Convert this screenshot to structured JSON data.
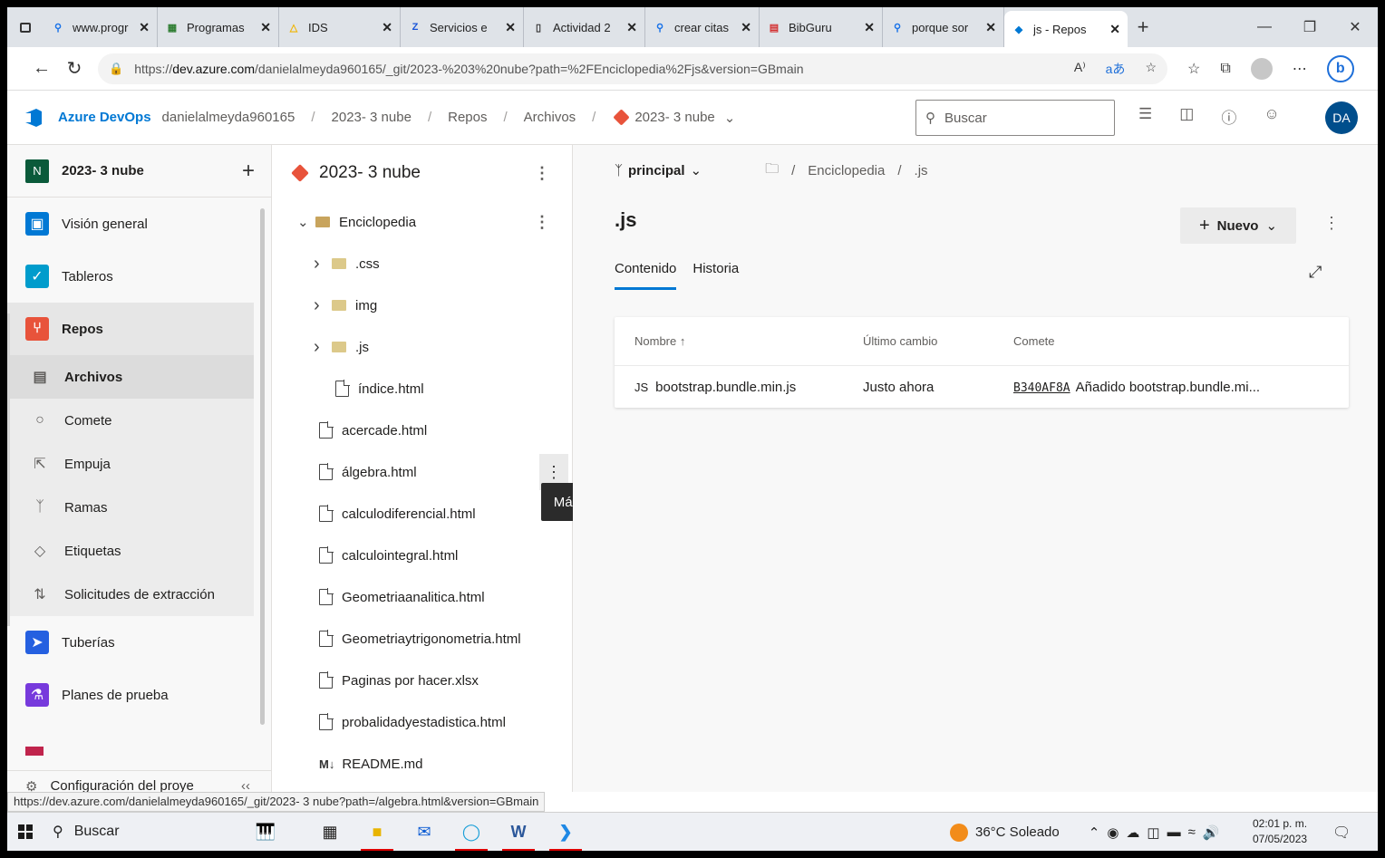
{
  "browser": {
    "tabs": [
      {
        "label": "www.progr",
        "icon": "search-icon",
        "color": "#1a73e8"
      },
      {
        "label": "Programas",
        "icon": "programs-icon",
        "color": "#2e7d32"
      },
      {
        "label": "IDS",
        "icon": "warning-icon",
        "color": "#f0b400"
      },
      {
        "label": "Servicios e",
        "icon": "z-icon",
        "color": "#1a55d8"
      },
      {
        "label": "Actividad 2",
        "icon": "page-icon",
        "color": "#333333"
      },
      {
        "label": "crear citas",
        "icon": "search-icon",
        "color": "#1a73e8"
      },
      {
        "label": "BibGuru",
        "icon": "book-icon",
        "color": "#d32f2f"
      },
      {
        "label": "porque sor",
        "icon": "search-icon",
        "color": "#1a73e8"
      },
      {
        "label": "js - Repos",
        "icon": "devops-icon",
        "color": "#0078d4",
        "active": true
      }
    ],
    "url_prefix": "https://",
    "url_host": "dev.azure.com",
    "url_path": "/danielalmeyda960165/_git/2023-%203%20nube?path=%2FEnciclopedia%2Fjs&version=GBmain",
    "read_aloud": "A⁾",
    "translate": "aあ"
  },
  "devops": {
    "brand": "Azure DevOps",
    "breadcrumbs": [
      "danielalmeyda960165",
      "2023- 3 nube",
      "Repos",
      "Archivos"
    ],
    "repo_picker": "2023- 3 nube",
    "search_placeholder": "Buscar",
    "avatar": "DA"
  },
  "sidebar": {
    "project": {
      "initial": "N",
      "name": "2023- 3 nube"
    },
    "items": [
      {
        "label": "Visión general",
        "icon": "overview-icon",
        "color": "#0078d4"
      },
      {
        "label": "Tableros",
        "icon": "boards-icon",
        "color": "#009ccc"
      },
      {
        "label": "Repos",
        "icon": "repos-icon",
        "color": "#e8533b",
        "selected": true
      },
      {
        "label": "Archivos",
        "icon": "files-icon",
        "sub": true,
        "selected": true
      },
      {
        "label": "Comete",
        "icon": "commit-icon",
        "sub": true
      },
      {
        "label": "Empuja",
        "icon": "push-icon",
        "sub": true
      },
      {
        "label": "Ramas",
        "icon": "branch-icon",
        "sub": true
      },
      {
        "label": "Etiquetas",
        "icon": "tag-icon",
        "sub": true
      },
      {
        "label": "Solicitudes de extracción",
        "icon": "pull-request-icon",
        "sub": true
      },
      {
        "label": "Tuberías",
        "icon": "pipelines-icon",
        "color": "#2560e0"
      },
      {
        "label": "Planes de prueba",
        "icon": "test-plans-icon",
        "color": "#773adc"
      }
    ],
    "config_label": "Configuración del proye"
  },
  "tree": {
    "title": "2023- 3 nube",
    "root": "Enciclopedia",
    "rows": [
      {
        "label": ".css",
        "kind": "folder",
        "depth": 1
      },
      {
        "label": "img",
        "kind": "folder",
        "depth": 1
      },
      {
        "label": ".js",
        "kind": "folder",
        "depth": 1
      },
      {
        "label": "índice.html",
        "kind": "code",
        "depth": 2
      },
      {
        "label": "acercade.html",
        "kind": "code",
        "depth": 0
      },
      {
        "label": "álgebra.html",
        "kind": "code",
        "depth": 0,
        "hover": true
      },
      {
        "label": "calculodiferencial.html",
        "kind": "code",
        "depth": 0
      },
      {
        "label": "calculointegral.html",
        "kind": "code",
        "depth": 0
      },
      {
        "label": "Geometriaanalitica.html",
        "kind": "code",
        "depth": 0
      },
      {
        "label": "Geometriaytrigonometria.html",
        "kind": "code",
        "depth": 0
      },
      {
        "label": "Paginas por hacer.xlsx",
        "kind": "file",
        "depth": 0
      },
      {
        "label": "probalidadyestadistica.html",
        "kind": "code",
        "depth": 0
      },
      {
        "label": "README.md",
        "kind": "md",
        "depth": 0
      }
    ],
    "tooltip": "Más opciones"
  },
  "main": {
    "branch": "principal",
    "path": [
      "Enciclopedia",
      ".js"
    ],
    "title": ".js",
    "new_button": "Nuevo",
    "tabs": [
      "Contenido",
      "Historia"
    ],
    "columns": [
      "Nombre",
      "Último cambio",
      "Comete"
    ],
    "files": [
      {
        "type": "JS",
        "name": "bootstrap.bundle.min.js",
        "changed": "Justo ahora",
        "commit": "B340AF8A",
        "message": "Añadido bootstrap.bundle.mi..."
      }
    ]
  },
  "status_url": "https://dev.azure.com/danielalmeyda960165/_git/2023- 3 nube?path=/algebra.html&version=GBmain",
  "taskbar": {
    "search": "Buscar",
    "weather": "36°C  Soleado",
    "time": "02:01 p. m.",
    "date": "07/05/2023"
  }
}
